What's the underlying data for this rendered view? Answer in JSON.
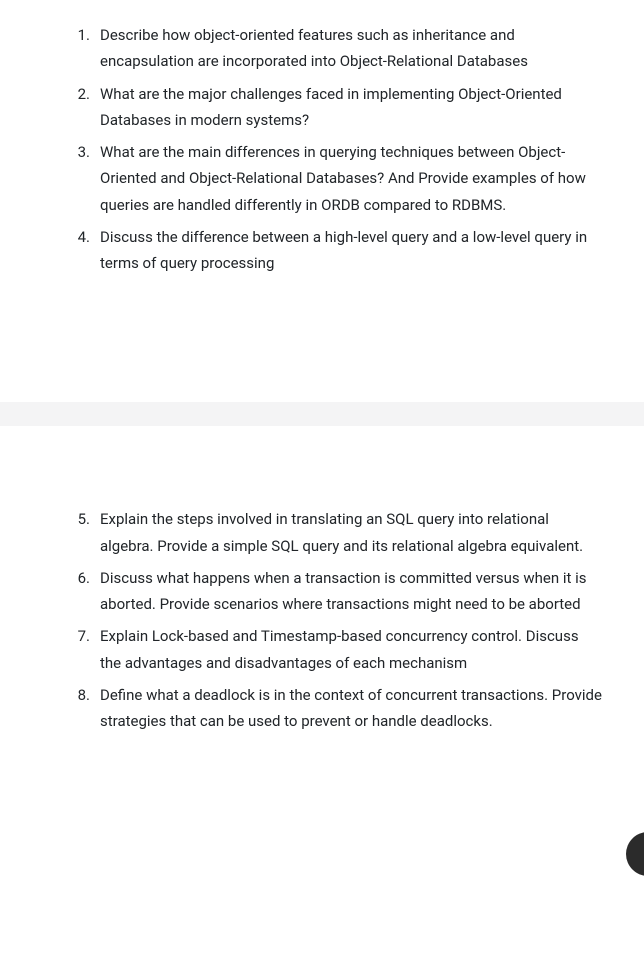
{
  "section1": {
    "items": [
      {
        "num": "1.",
        "text": "Describe how object-oriented features such as inheritance and encapsulation are incorporated into Object-Relational Databases"
      },
      {
        "num": "2.",
        "text": "What are the major challenges faced in implementing Object-Oriented Databases in modern systems?"
      },
      {
        "num": "3.",
        "text": "What are the main differences in querying techniques between Object-Oriented and Object-Relational Databases? And Provide examples of how queries are handled differently in ORDB compared to RDBMS."
      },
      {
        "num": "4.",
        "text": "Discuss the difference between a high-level query and a low-level query in terms of query processing"
      }
    ]
  },
  "section2": {
    "items": [
      {
        "num": "5.",
        "text": "Explain the steps involved in translating an SQL query into relational algebra. Provide a simple SQL query and its relational algebra equivalent."
      },
      {
        "num": "6.",
        "text": "Discuss what happens when a transaction is committed versus when it is aborted. Provide scenarios where transactions might need to be aborted"
      },
      {
        "num": "7.",
        "text": "Explain Lock-based and Timestamp-based concurrency control. Discuss the advantages and disadvantages of each mechanism"
      },
      {
        "num": "8.",
        "text": "Define what a deadlock is in the context of concurrent transactions. Provide strategies that can be used to prevent or handle deadlocks."
      }
    ]
  }
}
